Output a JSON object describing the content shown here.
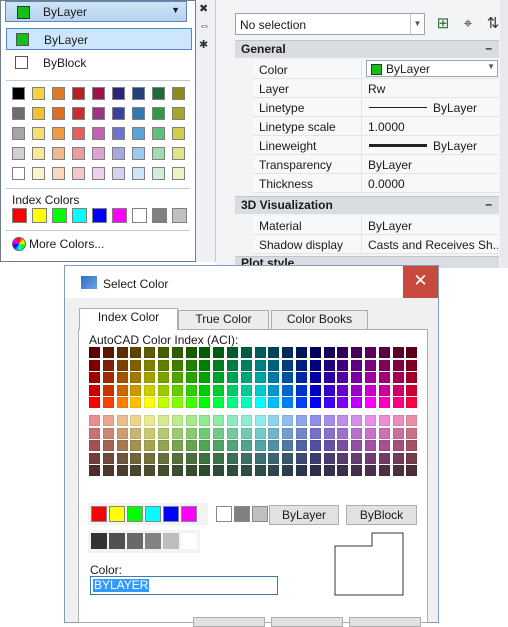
{
  "dropdown": {
    "header_label": "ByLayer",
    "items": [
      {
        "label": "ByLayer",
        "swatch": "#12c018"
      },
      {
        "label": "ByBlock",
        "swatch": "#ffffff"
      }
    ],
    "grid_colors": [
      [
        "#000000",
        "#f7d23e",
        "#e17924",
        "#b52020",
        "#a0134a",
        "#28257a",
        "#21427d",
        "#1e6b38",
        "#8a8c1a"
      ],
      [
        "#6d6d6d",
        "#f1c232",
        "#e06e22",
        "#c73030",
        "#9c3386",
        "#3a41a0",
        "#3178b0",
        "#2e9a48",
        "#a4a82a"
      ],
      [
        "#a6a6a6",
        "#f6df6e",
        "#f09a42",
        "#e26060",
        "#c361b3",
        "#6c73c9",
        "#5aa3d9",
        "#5ec07a",
        "#cfd04a"
      ],
      [
        "#d1d1d1",
        "#f9ea9b",
        "#f4b98a",
        "#ec9c9c",
        "#dca3d3",
        "#a5a9e0",
        "#9dc9ec",
        "#a2dcb0",
        "#e2e386"
      ],
      [
        "#ffffff",
        "#fdf4cc",
        "#f9d8bd",
        "#f5c8c8",
        "#eed0ea",
        "#d1d3f0",
        "#cde5f7",
        "#d1eedb",
        "#f1f2c4"
      ]
    ],
    "index_colors_label": "Index Colors",
    "index_colors": [
      "#ff0000",
      "#ffff00",
      "#00ff00",
      "#00ffff",
      "#0000ff",
      "#ff00ff",
      "#ffffff",
      "#808080",
      "#c0c0c0"
    ],
    "more_colors_label": "More Colors..."
  },
  "properties": {
    "selection": "No selection",
    "sections": {
      "general": "General",
      "viz3d": "3D Visualization",
      "plot": "Plot style"
    },
    "general_rows": [
      {
        "key": "Color",
        "value": "ByLayer"
      },
      {
        "key": "Layer",
        "value": "Rw"
      },
      {
        "key": "Linetype",
        "value": "ByLayer"
      },
      {
        "key": "Linetype scale",
        "value": "1.0000"
      },
      {
        "key": "Lineweight",
        "value": "ByLayer"
      },
      {
        "key": "Transparency",
        "value": "ByLayer"
      },
      {
        "key": "Thickness",
        "value": "0.0000"
      }
    ],
    "viz_rows": [
      {
        "key": "Material",
        "value": "ByLayer"
      },
      {
        "key": "Shadow display",
        "value": "Casts and Receives Sh..."
      }
    ]
  },
  "dialog": {
    "title": "Select Color",
    "close": "✕",
    "tabs": [
      "Index Color",
      "True Color",
      "Color Books"
    ],
    "aci_label": "AutoCAD Color Index (ACI):",
    "standard_colors": [
      "#ff0000",
      "#ffff00",
      "#00ff00",
      "#00ffff",
      "#0000ff",
      "#ff00ff",
      "#ffffff",
      "#808080",
      "#c0c0c0"
    ],
    "gray_colors": [
      "#333333",
      "#505050",
      "#696969",
      "#828282",
      "#bebebe",
      "#ffffff"
    ],
    "bylayer_button": "ByLayer",
    "byblock_button": "ByBlock",
    "color_label": "Color:",
    "color_value": "BYLAYER"
  }
}
